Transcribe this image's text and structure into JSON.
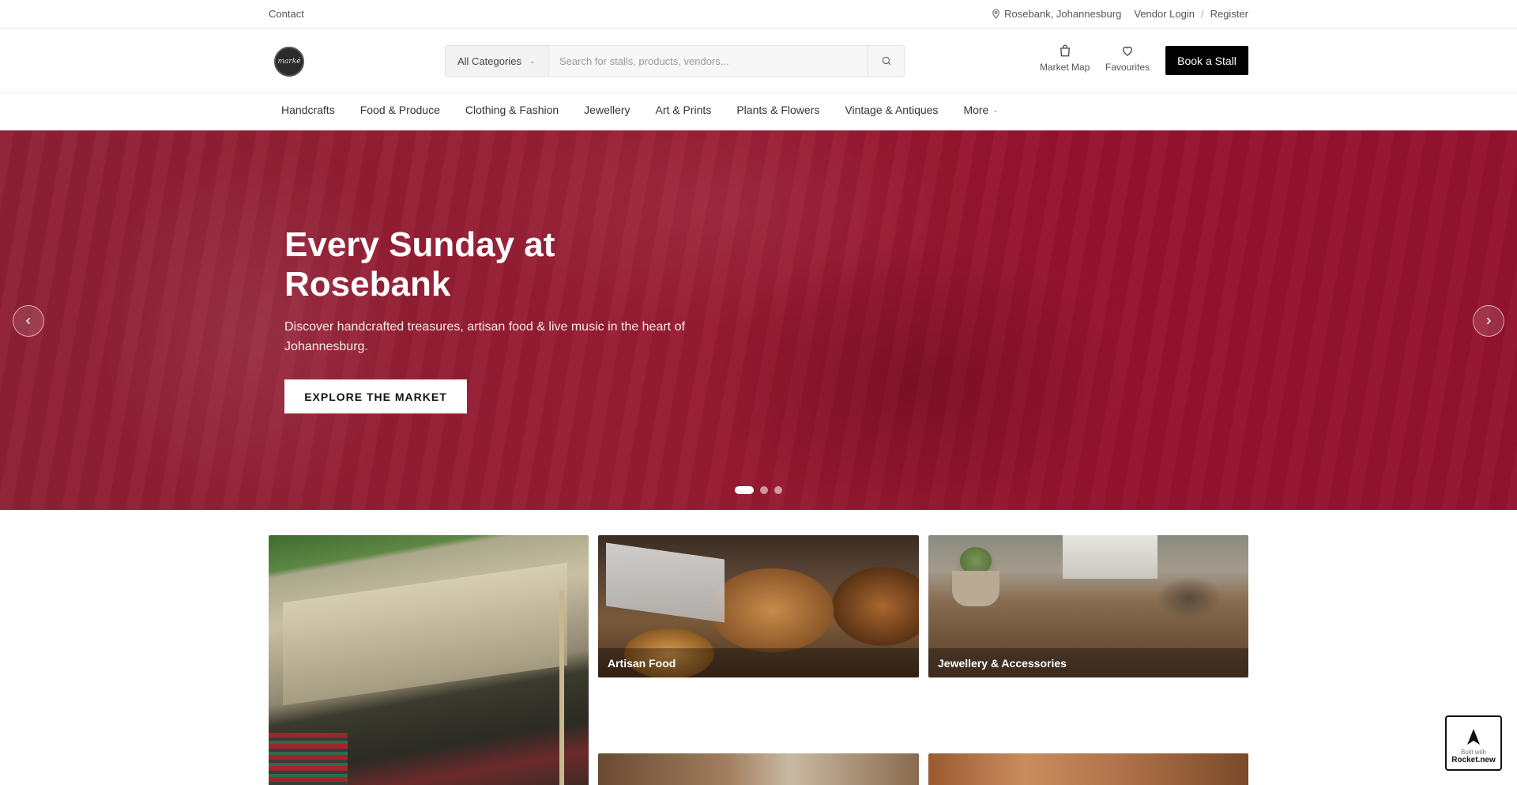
{
  "topbar": {
    "contact": "Contact",
    "location": "Rosebank, Johannesburg",
    "vendor_login": "Vendor Login",
    "separator": "/",
    "register": "Register"
  },
  "header": {
    "logo_text": "marké",
    "search": {
      "category": "All Categories",
      "placeholder": "Search for stalls, products, vendors..."
    },
    "actions": {
      "market_map": "Market Map",
      "favourites": "Favourites"
    },
    "book_stall": "Book a Stall"
  },
  "nav": {
    "items": [
      "Handcrafts",
      "Food & Produce",
      "Clothing & Fashion",
      "Jewellery",
      "Art & Prints",
      "Plants & Flowers",
      "Vintage & Antiques",
      "More"
    ]
  },
  "hero": {
    "title": "Every Sunday at Rosebank",
    "subtitle": "Discover handcrafted treasures, artisan food & live music in the heart of Johannesburg.",
    "cta": "EXPLORE THE MARKET",
    "slides": 3,
    "active_slide": 1,
    "tint": "#9a1f35"
  },
  "categories": {
    "tiles": [
      "Artisan Food",
      "Jewellery & Accessories"
    ]
  },
  "badge": {
    "small": "Built with",
    "big": "Rocket.new"
  },
  "colors": {
    "accent": "#000000",
    "hero_overlay": "#9a1f35"
  }
}
